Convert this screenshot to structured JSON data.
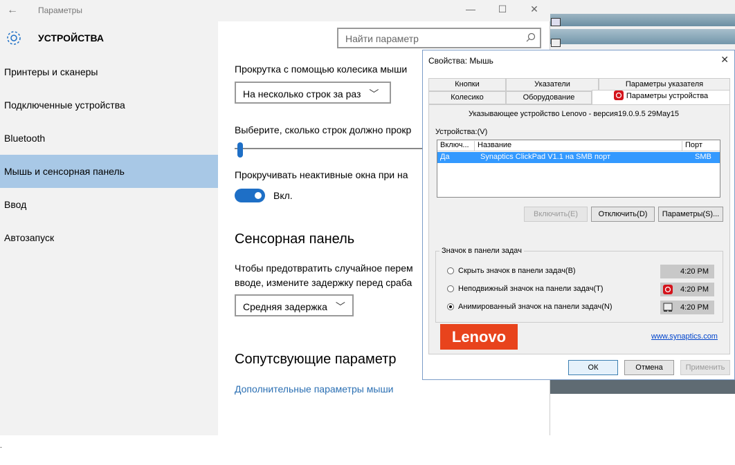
{
  "settings": {
    "title": "Параметры",
    "header": "УСТРОЙСТВА",
    "search_placeholder": "Найти параметр",
    "nav": [
      {
        "label": "Принтеры и сканеры"
      },
      {
        "label": "Подключенные устройства"
      },
      {
        "label": "Bluetooth"
      },
      {
        "label": "Мышь и сенсорная панель"
      },
      {
        "label": "Ввод"
      },
      {
        "label": "Автозапуск"
      }
    ],
    "scroll_label": "Прокрутка с помощью колесика мыши",
    "scroll_value": "На несколько строк за раз",
    "lines_label": "Выберите, сколько строк должно прокр",
    "lines_slider_value": 0.03,
    "inactive_label": "Прокручивать неактивные окна при на",
    "toggle_label": "Вкл.",
    "touchpad_heading": "Сенсорная панель",
    "touchpad_desc1": "Чтобы предотвратить случайное перем",
    "touchpad_desc2": "вводе, измените задержку перед сраба",
    "delay_value": "Средняя задержка",
    "related_heading": "Сопутсвующие параметр",
    "mouse_link": "Дополнительные параметры мыши"
  },
  "dialog": {
    "title": "Свойства: Мышь",
    "tabs_row1": [
      "Кнопки",
      "Указатели",
      "Параметры указателя"
    ],
    "tabs_row2": [
      "Колесико",
      "Оборудование",
      "Параметры устройства"
    ],
    "driver_text": "Указывающее устройство Lenovo - версия19.0.9.5 29May15",
    "devices_label": "Устройства:(V)",
    "columns": [
      "Включ...",
      "Название",
      "Порт"
    ],
    "row": {
      "enabled": "Да",
      "name": "Synaptics ClickPad V1.1 на SMB порт",
      "port": "SMB"
    },
    "btn_enable": "Включить(E)",
    "btn_disable": "Отключить(D)",
    "btn_params": "Параметры(S)...",
    "group_label": "Значок в панели задач",
    "radios": [
      {
        "label": "Скрыть значок в панели задач(B)",
        "time": "4:20 PM"
      },
      {
        "label": "Неподвижный значок на панели задач(T)",
        "time": "4:20 PM"
      },
      {
        "label": "Анимированный значок на панели задач(N)",
        "time": "4:20 PM"
      }
    ],
    "logo_text": "Lenovo",
    "synaptics_link": "www.synaptics.com",
    "ok": "ОК",
    "cancel": "Отмена",
    "apply": "Применить"
  },
  "colors": {
    "accent": "#1e6fc6",
    "selected_nav": "#a8c8e6",
    "lenovo": "#e8431c"
  },
  "footnote": "."
}
